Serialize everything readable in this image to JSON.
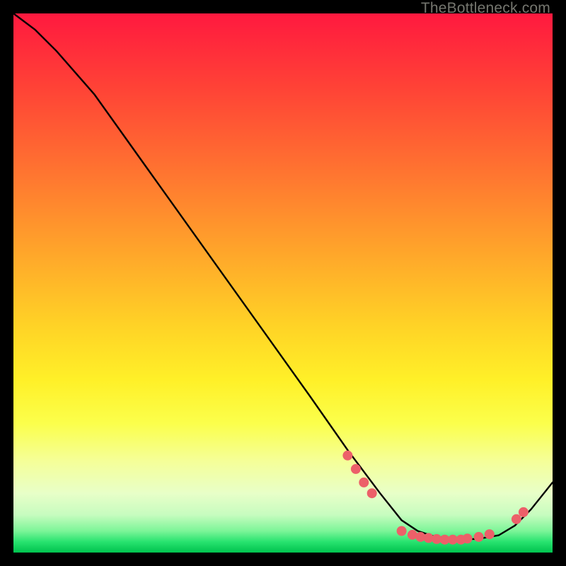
{
  "watermark": {
    "text": "TheBottleneck.com"
  },
  "colors": {
    "curve_stroke": "#000000",
    "marker_fill": "#ec6069",
    "marker_stroke": "#ec6069",
    "background": "#000000"
  },
  "chart_data": {
    "type": "line",
    "title": "",
    "xlabel": "",
    "ylabel": "",
    "xlim": [
      0,
      100
    ],
    "ylim": [
      0,
      100
    ],
    "note": "No axes or tick labels are rendered; values are normalized 0–100 estimated from pixel positions. y=100 is the top of the gradient panel (worst bottleneck, red), y≈0 is the bottom (green, optimal).",
    "series": [
      {
        "name": "bottleneck-curve",
        "x": [
          0,
          4,
          8,
          15,
          25,
          35,
          45,
          55,
          62,
          68,
          72,
          75,
          78,
          82,
          86,
          90,
          93,
          96,
          100
        ],
        "y": [
          100,
          97,
          93,
          85,
          71,
          57,
          43,
          29,
          19,
          11,
          6,
          4,
          3,
          2.5,
          2.5,
          3.2,
          5,
          8,
          13
        ]
      }
    ],
    "markers": {
      "name": "highlighted-points",
      "points": [
        {
          "x": 62,
          "y": 18
        },
        {
          "x": 63.5,
          "y": 15.5
        },
        {
          "x": 65,
          "y": 13
        },
        {
          "x": 66.5,
          "y": 11
        },
        {
          "x": 72,
          "y": 4
        },
        {
          "x": 74,
          "y": 3.3
        },
        {
          "x": 75.5,
          "y": 2.9
        },
        {
          "x": 77,
          "y": 2.7
        },
        {
          "x": 78.5,
          "y": 2.5
        },
        {
          "x": 80,
          "y": 2.4
        },
        {
          "x": 81.5,
          "y": 2.4
        },
        {
          "x": 83,
          "y": 2.4
        },
        {
          "x": 84.2,
          "y": 2.6
        },
        {
          "x": 86.3,
          "y": 2.9
        },
        {
          "x": 88.3,
          "y": 3.4
        },
        {
          "x": 93.3,
          "y": 6.2
        },
        {
          "x": 94.6,
          "y": 7.5
        }
      ]
    }
  }
}
